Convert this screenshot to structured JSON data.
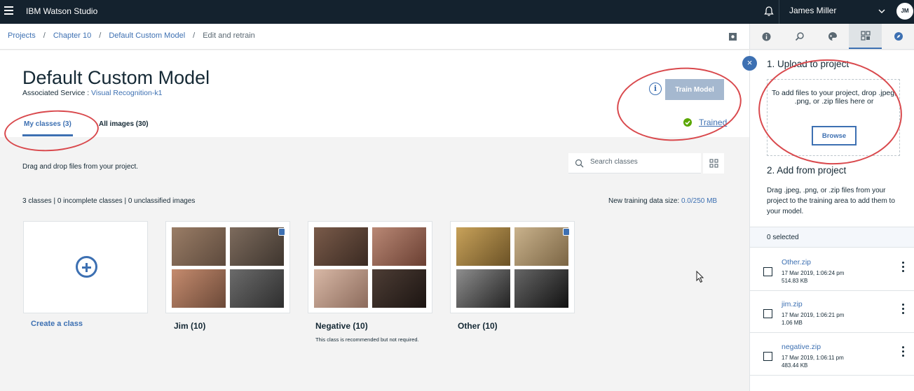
{
  "app": {
    "brand": "IBM Watson Studio",
    "user_name": "James Miller",
    "user_initials": "JM"
  },
  "breadcrumb": [
    {
      "label": "Projects"
    },
    {
      "label": "Chapter 10"
    },
    {
      "label": "Default Custom Model"
    },
    {
      "label": "Edit and retrain"
    }
  ],
  "breadcrumb_sep": "/",
  "header": {
    "title": "Default Custom Model",
    "assoc_label": "Associated Service : ",
    "assoc_link": "Visual Recognition-k1",
    "train_label": "Train Model",
    "info_label": "i",
    "trained_label": "Trained"
  },
  "tabs": [
    {
      "label": "My classes (3)"
    },
    {
      "label": "All images (30)"
    }
  ],
  "content": {
    "drag_text": "Drag and drop files from your project.",
    "search_placeholder": "Search classes",
    "stats": "3 classes | 0 incomplete classes | 0 unclassified images",
    "size_label": "New training data size: ",
    "size_value": "0.0/250 MB",
    "create_label": "Create a class"
  },
  "classes": [
    {
      "label": "Jim (10)"
    },
    {
      "label": "Negative (10)",
      "note": "This class is recommended but not required."
    },
    {
      "label": "Other (10)"
    }
  ],
  "panel": {
    "sec1_title": "1. Upload to project",
    "drop_text": "To add files to your project, drop .jpeg, .png, or .zip files here or",
    "browse_label": "Browse",
    "sec2_title": "2. Add from project",
    "sec2_text": "Drag .jpeg, .png, or .zip files from your project to the training area to add them to your model.",
    "selected": "0 selected",
    "close_label": "×",
    "files": [
      {
        "name": "Other.zip",
        "date": "17 Mar 2019, 1:06:24 pm",
        "size": "514.83 KB"
      },
      {
        "name": "jim.zip",
        "date": "17 Mar 2019, 1:06:21 pm",
        "size": "1.06 MB"
      },
      {
        "name": "negative.zip",
        "date": "17 Mar 2019, 1:06:11 pm",
        "size": "483.44 KB"
      }
    ]
  },
  "colors": {
    "accent": "#3d70b2",
    "topbar": "#14222e",
    "annotation": "#d9494d",
    "success": "#5aa700"
  }
}
